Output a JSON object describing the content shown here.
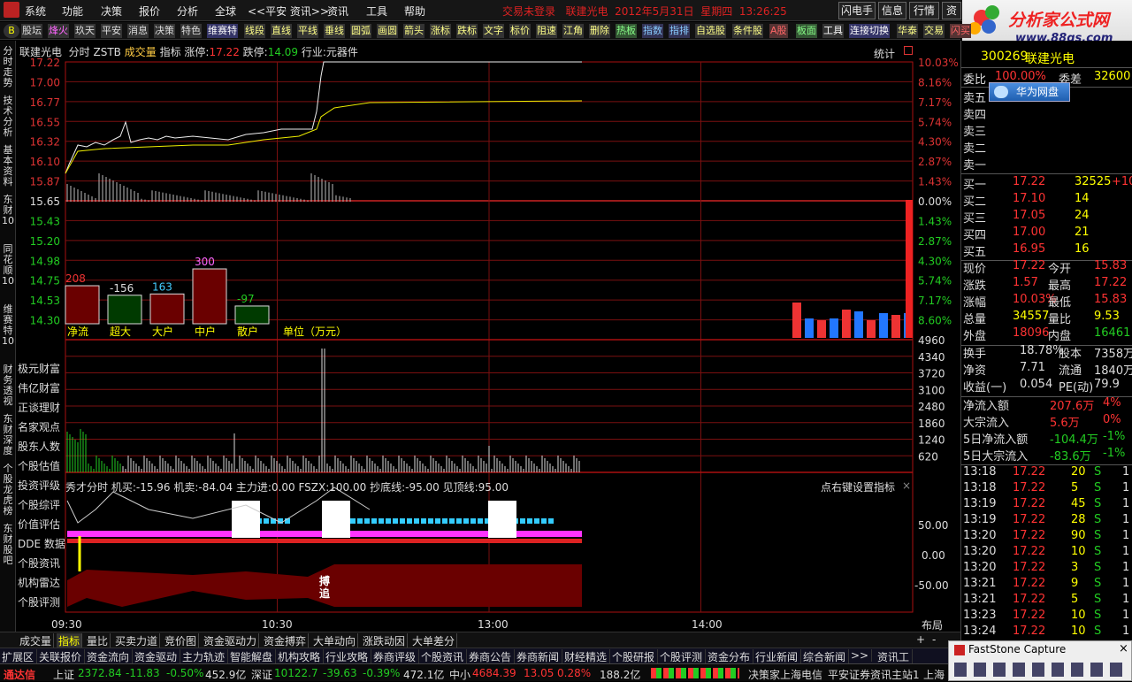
{
  "menu": {
    "items": [
      "系统",
      "功能",
      "决策",
      "报价",
      "分析",
      "全球",
      "<<平安 资讯>>",
      "资讯",
      "工具",
      "帮助"
    ],
    "status": "交易未登录",
    "stock": "联建光电",
    "date": "2012年5月31日",
    "weekday": "星期四",
    "time": "13:26:25",
    "right_buttons": [
      "闪电手",
      "信息",
      "行情",
      "资"
    ]
  },
  "logo": {
    "title": "分析家公式网",
    "url": "www.88gs.com"
  },
  "toolbar": {
    "items": [
      "股坛",
      "烽火",
      "玖天",
      "平安",
      "消息",
      "决策",
      "特色",
      "维赛特",
      "线段",
      "直线",
      "平线",
      "垂线",
      "圆弧",
      "画圆",
      "箭头",
      "涨标",
      "跌标",
      "文字",
      "标价",
      "阻速",
      "江角",
      "删除",
      "热板",
      "指数",
      "指排",
      "自选股",
      "条件股",
      "A股",
      "板面",
      "工具",
      "连接切换",
      "华泰",
      "交易",
      "闪买"
    ]
  },
  "leftnav": [
    "分时走势",
    "技术分析",
    "基本资料",
    "东财10",
    "同花顺10",
    "维赛特10",
    "财务透视",
    "东财深度",
    "个股龙虎榜",
    "东财股吧"
  ],
  "chart": {
    "header": {
      "name": "联建光电",
      "mode": "分时",
      "code": "ZSTB",
      "vol": "成交量",
      "ind": "指标",
      "limit_up_label": "涨停:",
      "limit_up": "17.22",
      "limit_down_label": "跌停:",
      "limit_down": "14.09",
      "industry": "行业:元器件",
      "stat": "统计"
    },
    "price_labels": [
      "17.22",
      "17.00",
      "16.77",
      "16.55",
      "16.32",
      "16.10",
      "15.87",
      "15.65",
      "15.43",
      "15.20",
      "14.98",
      "14.75",
      "14.53",
      "14.30"
    ],
    "pct_labels": [
      "10.03%",
      "8.16%",
      "7.17%",
      "5.74%",
      "4.30%",
      "2.87%",
      "1.43%",
      "0.00%",
      "1.43%",
      "2.87%",
      "4.30%",
      "5.74%",
      "7.17%",
      "8.60%"
    ],
    "vol_labels": [
      "4960",
      "4340",
      "3720",
      "3100",
      "2480",
      "1860",
      "1240",
      "620"
    ],
    "times": [
      "09:30",
      "10:30",
      "13:00",
      "14:00"
    ],
    "capital_flow": {
      "labels": [
        "净流",
        "超大",
        "大户",
        "中户",
        "散户"
      ],
      "values": [
        208,
        -156,
        163,
        300,
        -97
      ],
      "unit": "单位（万元）"
    },
    "left_menu": [
      "极元财富",
      "伟亿财富",
      "正谈理财",
      "名家观点",
      "股东人数",
      "个股估值",
      "投资评级",
      "个股综评",
      "价值评估",
      "DDE 数据",
      "个股资讯",
      "机构雷达",
      "个股评测"
    ],
    "indicator": {
      "text": "秀才分时  机买:-15.96  机卖:-84.04  主力进:0.00  FSZX:100.00  抄底线:-95.00  见顶线:95.00",
      "hint": "点右键设置指标",
      "levels": [
        "50.00",
        "0.00",
        "-50.00"
      ],
      "badge_top": "搏",
      "badge_bot": "追"
    },
    "layout_label": "布局"
  },
  "right": {
    "code": "300269",
    "name": "联建光电",
    "weibi_label": "委比",
    "weibi": "100.00%",
    "weicha_label": "委差",
    "weicha": "32600",
    "sell_labels": [
      "卖五",
      "卖四",
      "卖三",
      "卖二",
      "卖一"
    ],
    "buys": [
      {
        "l": "买一",
        "p": "17.22",
        "v": "32525",
        "c": "+10"
      },
      {
        "l": "买二",
        "p": "17.10",
        "v": "14",
        "c": ""
      },
      {
        "l": "买三",
        "p": "17.05",
        "v": "24",
        "c": ""
      },
      {
        "l": "买四",
        "p": "17.00",
        "v": "21",
        "c": ""
      },
      {
        "l": "买五",
        "p": "16.95",
        "v": "16",
        "c": ""
      }
    ],
    "quote": [
      [
        "现价",
        "17.22",
        "今开",
        "15.83"
      ],
      [
        "涨跌",
        "1.57",
        "最高",
        "17.22"
      ],
      [
        "涨幅",
        "10.03%",
        "最低",
        "15.83"
      ],
      [
        "总量",
        "34557",
        "量比",
        "9.53"
      ],
      [
        "外盘",
        "18096",
        "内盘",
        "16461"
      ]
    ],
    "info": [
      [
        "换手",
        "18.78%",
        "股本",
        "7358万"
      ],
      [
        "净资",
        "7.71",
        "流通",
        "1840万"
      ],
      [
        "收益(一)",
        "0.054",
        "PE(动)",
        "79.9"
      ]
    ],
    "flows": [
      [
        "净流入额",
        "207.6万",
        "4%"
      ],
      [
        "大宗流入",
        "5.6万",
        "0%"
      ],
      [
        "5日净流入额",
        "-104.4万",
        "-1%"
      ],
      [
        "5日大宗流入",
        "-83.6万",
        "-1%"
      ]
    ],
    "ticks": [
      [
        "13:18",
        "17.22",
        "20",
        "S"
      ],
      [
        "13:18",
        "17.22",
        "5",
        "S"
      ],
      [
        "13:19",
        "17.22",
        "45",
        "S"
      ],
      [
        "13:19",
        "17.22",
        "28",
        "S"
      ],
      [
        "13:20",
        "17.22",
        "90",
        "S"
      ],
      [
        "13:20",
        "17.22",
        "10",
        "S"
      ],
      [
        "13:20",
        "17.22",
        "3",
        "S"
      ],
      [
        "13:21",
        "17.22",
        "9",
        "S"
      ],
      [
        "13:21",
        "17.22",
        "5",
        "S"
      ],
      [
        "13:23",
        "17.22",
        "10",
        "S"
      ],
      [
        "13:24",
        "17.22",
        "10",
        "S"
      ]
    ],
    "popup": "华为网盘"
  },
  "bottom_tabs": [
    "成交量",
    "指标",
    "量比",
    "买卖力道",
    "竞价图",
    "资金驱动力",
    "资金搏弈",
    "大单动向",
    "涨跌动因",
    "大单差分"
  ],
  "nav_row": [
    "扩展区",
    "关联报价",
    "资金流向",
    "资金驱动",
    "主力轨迹",
    "智能解盘",
    "机构攻略",
    "行业攻略",
    "券商评级",
    "个股资讯",
    "券商公告",
    "券商新闻",
    "财经精选",
    "个股研报",
    "个股评测",
    "资金分布",
    "行业新闻",
    "综合新闻",
    ">>",
    "资讯工"
  ],
  "status": {
    "brand": "通达信",
    "sh_label": "上证",
    "sh": "2372.84",
    "sh_chg": "-11.83",
    "sh_pct": "-0.50%",
    "sh_amt": "452.9亿",
    "sz_label": "深证",
    "sz": "10122.7",
    "sz_chg": "-39.63",
    "sz_pct": "-0.39%",
    "sz_amt": "472.1亿",
    "zx_label": "中小",
    "zx": "4684.39",
    "zx_chg": "13.05",
    "zx_pct": "0.28%",
    "zx_amt": "188.2亿",
    "t1": "决策家上海电信",
    "t2": "平安证券资讯主站1",
    "t3": "上海"
  },
  "fscap": "FastStone Capture",
  "colors": {
    "up": "#ff3a3a",
    "down": "#22cc22",
    "grid": "#7a1010",
    "yellow": "#ffff00",
    "cyan": "#33ccff",
    "magenta": "#ff33ff"
  }
}
